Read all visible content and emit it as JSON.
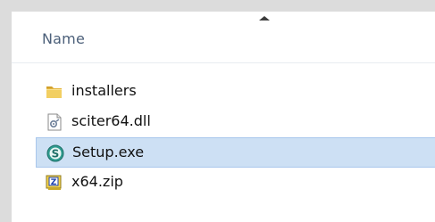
{
  "list": {
    "column_name": "Name",
    "sort_direction": "ascending",
    "selection_color": "#cde0f4",
    "items": [
      {
        "name": "installers",
        "type": "folder",
        "icon": "folder-icon",
        "selected": false
      },
      {
        "name": "sciter64.dll",
        "type": "dll",
        "icon": "dll-file-icon",
        "selected": false
      },
      {
        "name": "Setup.exe",
        "type": "exe",
        "icon": "setup-exe-icon",
        "selected": true
      },
      {
        "name": "x64.zip",
        "type": "zip",
        "icon": "zip-archive-icon",
        "selected": false
      }
    ]
  }
}
